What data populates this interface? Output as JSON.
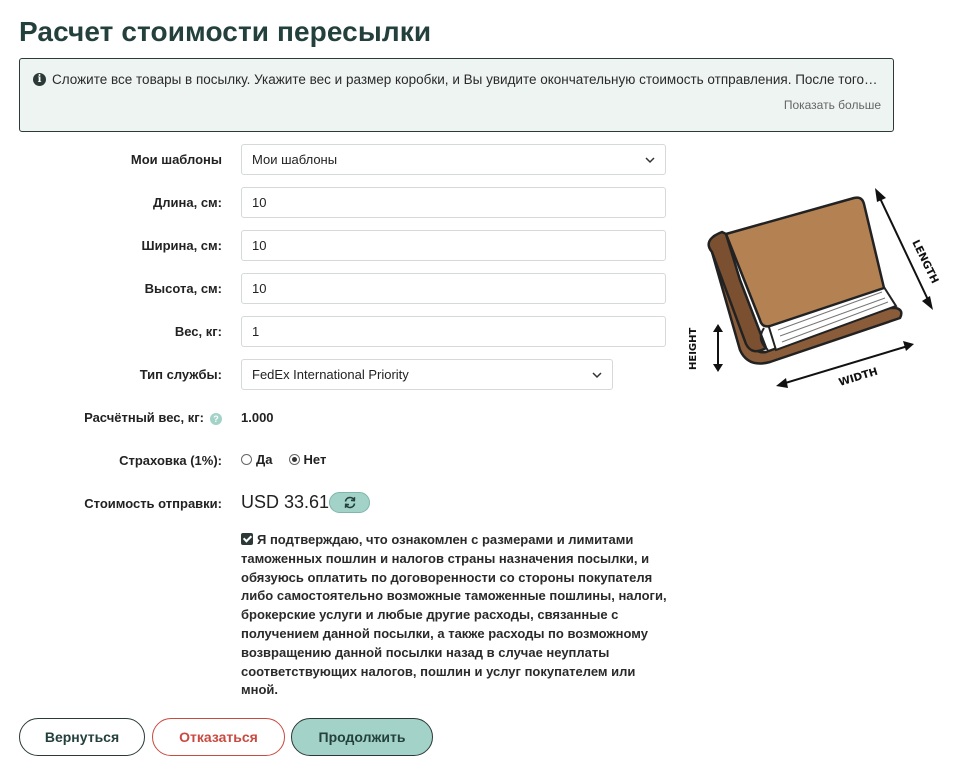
{
  "page": {
    "title": "Расчет стоимости пересылки"
  },
  "info": {
    "text": "Сложите все товары в посылку. Укажите вес и размер коробки, и Вы увидите окончательную стоимость отправления. После того, ка...",
    "show_more": "Показать больше"
  },
  "form": {
    "templates": {
      "label": "Мои шаблоны",
      "value": "Мои шаблоны"
    },
    "length": {
      "label": "Длина, см:",
      "value": "10"
    },
    "width": {
      "label": "Ширина, см:",
      "value": "10"
    },
    "height": {
      "label": "Высота, см:",
      "value": "10"
    },
    "weight": {
      "label": "Вес, кг:",
      "value": "1"
    },
    "service": {
      "label": "Тип службы:",
      "value": "FedEx International Priority"
    },
    "calc_weight": {
      "label": "Расчётный вес, кг:",
      "value": "1.000"
    },
    "insurance": {
      "label": "Страховка (1%):",
      "yes": "Да",
      "no": "Нет",
      "selected": "Нет"
    },
    "cost": {
      "label": "Стоимость отправки:",
      "value": "USD 33.61"
    },
    "confirm_text": "Я подтверждаю, что ознакомлен с размерами и лимитами таможенных пошлин и налогов страны назначения посылки, и обязуюсь оплатить по договоренности со стороны покупателя либо самостоятельно возможные таможенные пошлины, налоги, брокерские услуги и любые другие расходы, связанные с получением данной посылки, а также расходы по возможному возвращению данной посылки назад в случае неуплаты соответствующих налогов, пошлин и услуг покупателем или мной."
  },
  "diagram": {
    "length": "LENGTH",
    "width": "WIDTH",
    "height": "HEIGHT"
  },
  "buttons": {
    "back": "Вернуться",
    "cancel": "Отказаться",
    "continue": "Продолжить"
  },
  "colors": {
    "accent": "#a3d3c8",
    "dark": "#24403c",
    "danger": "#c84a40",
    "book_cover": "#b48153"
  }
}
